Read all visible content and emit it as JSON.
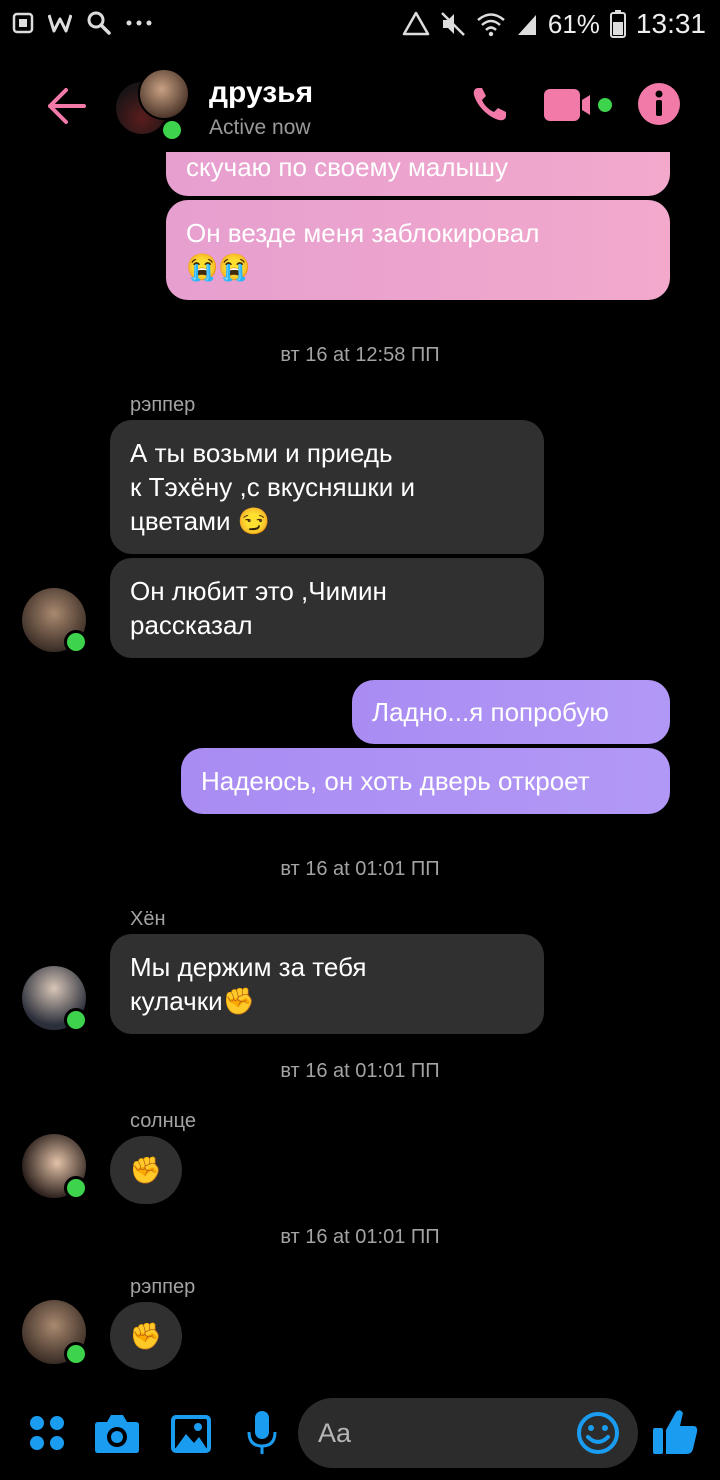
{
  "status_bar": {
    "battery_percent": "61%",
    "time": "13:31"
  },
  "header": {
    "title": "друзья",
    "subtitle": "Active now",
    "accent_color": "#f27aa9"
  },
  "messages": {
    "top_partial": "скучаю по своему малышу",
    "out1": "Он везде меня заблокировал",
    "out1_emoji": "😭😭",
    "ts1": "вт 16 at 12:58 ПП",
    "sender1": "рэппер",
    "in1_line1": "А ты возьми и приедь",
    "in1_line2": "к Тэхёну ,с вкусняшки и",
    "in1_line3": "цветами",
    "in1_emoji": "😏",
    "in2_line1": "Он любит это ,Чимин",
    "in2_line2": "рассказал",
    "out2": "Ладно...я попробую",
    "out3": "Надеюсь, он хоть дверь откроет",
    "ts2": "вт 16 at 01:01 ПП",
    "sender2": "Хён",
    "in3_line1": "Мы держим за тебя",
    "in3_line2": "кулачки",
    "in3_emoji": "✊",
    "ts3": "вт 16 at 01:01 ПП",
    "sender3": "солнце",
    "in4_emoji": "✊",
    "ts4": "вт 16 at 01:01 ПП",
    "sender4": "рэппер",
    "in5_emoji": "✊"
  },
  "composer": {
    "placeholder": "Aa"
  },
  "icons": [
    "back-arrow-icon",
    "phone-icon",
    "video-camera-icon",
    "info-icon",
    "apps-icon",
    "camera-icon",
    "image-icon",
    "microphone-icon",
    "emoji-icon",
    "thumbs-up-icon"
  ]
}
